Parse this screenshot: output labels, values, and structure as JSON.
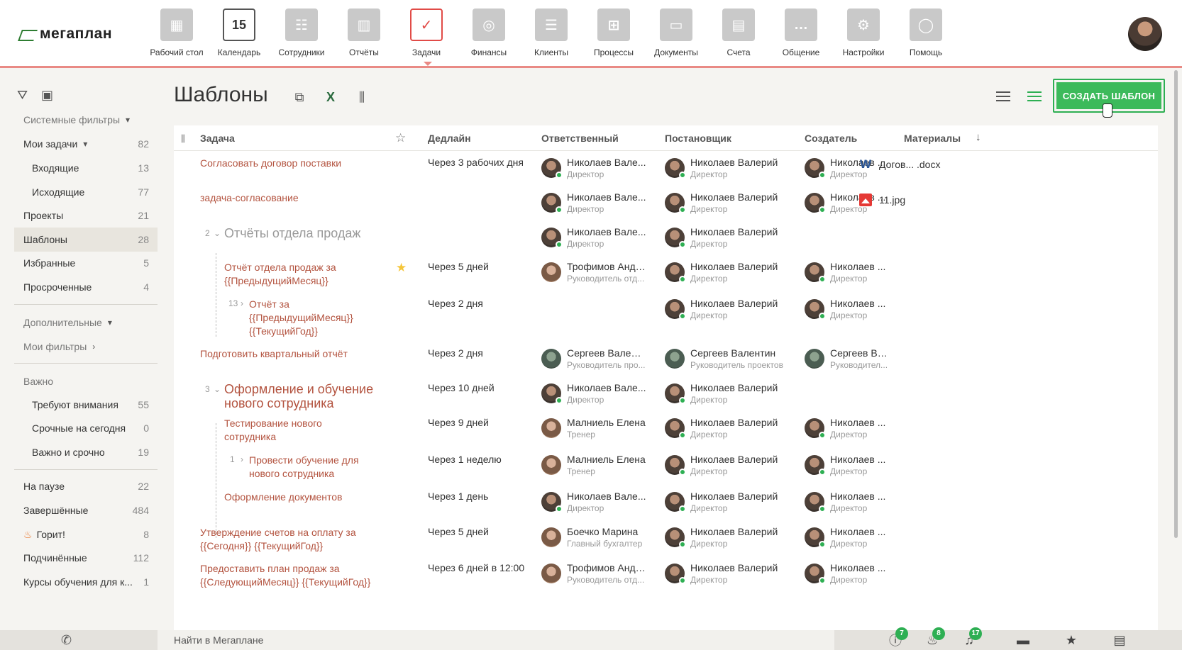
{
  "app": {
    "logo": "мегаплан"
  },
  "nav": [
    {
      "label": "Рабочий стол",
      "icon": "desktop-icon"
    },
    {
      "label": "Календарь",
      "icon": "calendar-icon",
      "day": "15"
    },
    {
      "label": "Сотрудники",
      "icon": "employees-icon"
    },
    {
      "label": "Отчёты",
      "icon": "reports-icon"
    },
    {
      "label": "Задачи",
      "icon": "tasks-icon",
      "active": true
    },
    {
      "label": "Финансы",
      "icon": "safe-icon"
    },
    {
      "label": "Клиенты",
      "icon": "clients-icon"
    },
    {
      "label": "Процессы",
      "icon": "processes-icon"
    },
    {
      "label": "Документы",
      "icon": "folder-icon"
    },
    {
      "label": "Счета",
      "icon": "invoice-icon"
    },
    {
      "label": "Общение",
      "icon": "chat-icon"
    },
    {
      "label": "Настройки",
      "icon": "gear-icon"
    },
    {
      "label": "Помощь",
      "icon": "lifebuoy-icon"
    }
  ],
  "sidebar": {
    "system_filters": "Системные фильтры",
    "items": [
      {
        "label": "Мои задачи",
        "count": "82"
      },
      {
        "label": "Входящие",
        "count": "13"
      },
      {
        "label": "Исходящие",
        "count": "77"
      },
      {
        "label": "Проекты",
        "count": "21"
      },
      {
        "label": "Шаблоны",
        "count": "28"
      },
      {
        "label": "Избранные",
        "count": "5"
      },
      {
        "label": "Просроченные",
        "count": "4"
      }
    ],
    "additional": "Дополнительные",
    "my_filters": "Мои фильтры",
    "important": "Важно",
    "important_items": [
      {
        "label": "Требуют внимания",
        "count": "55"
      },
      {
        "label": "Срочные на сегодня",
        "count": "0"
      },
      {
        "label": "Важно и срочно",
        "count": "19"
      }
    ],
    "bottom_items": [
      {
        "label": "На паузе",
        "count": "22"
      },
      {
        "label": "Завершённые",
        "count": "484"
      },
      {
        "label": "Горит!",
        "count": "8"
      },
      {
        "label": "Подчинённые",
        "count": "112"
      },
      {
        "label": "Курсы обучения для к...",
        "count": "1"
      }
    ]
  },
  "main": {
    "title": "Шаблоны",
    "create_button": "СОЗДАТЬ ШАБЛОН"
  },
  "table": {
    "columns": {
      "task": "Задача",
      "deadline": "Дедлайн",
      "responsible": "Ответственный",
      "setter": "Постановщик",
      "creator": "Создатель",
      "materials": "Материалы"
    },
    "rows": [
      {
        "task": "Согласовать договор поставки",
        "deadline": "Через 3 рабочих дня",
        "resp": {
          "name": "Николаев Вале...",
          "role": "Директор"
        },
        "setter": {
          "name": "Николаев Валерий",
          "role": "Директор"
        },
        "creator": {
          "name": "Николаев ...",
          "role": "Директор"
        },
        "file": "Догов... .docx"
      },
      {
        "task": "задача-согласование",
        "deadline": "",
        "resp": {
          "name": "Николаев Вале...",
          "role": "Директор"
        },
        "setter": {
          "name": "Николаев Валерий",
          "role": "Директор"
        },
        "creator": {
          "name": "Николаев ...",
          "role": "Директор"
        },
        "file": "11.jpg"
      },
      {
        "num": "2",
        "task": "Отчёты отдела продаж",
        "deadline": "",
        "resp": {
          "name": "Николаев Вале...",
          "role": "Директор"
        },
        "setter": {
          "name": "Николаев Валерий",
          "role": "Директор"
        }
      },
      {
        "task1": "Отчёт отдела продаж за",
        "task2": "{{ПредыдущийМесяц}}",
        "deadline": "Через 5 дней",
        "resp": {
          "name": "Трофимов Андр...",
          "role": "Руководитель отд..."
        },
        "setter": {
          "name": "Николаев Валерий",
          "role": "Директор"
        },
        "creator": {
          "name": "Николаев ...",
          "role": "Директор"
        }
      },
      {
        "num": "13",
        "task1": "Отчёт за",
        "task2": "{{ПредыдущийМесяц}}",
        "task3": "{{ТекущийГод}}",
        "deadline": "Через 2 дня",
        "setter": {
          "name": "Николаев Валерий",
          "role": "Директор"
        },
        "creator": {
          "name": "Николаев ...",
          "role": "Директор"
        }
      },
      {
        "task": "Подготовить квартальный отчёт",
        "deadline": "Через 2 дня",
        "resp": {
          "name": "Сергеев Валент...",
          "role": "Руководитель про..."
        },
        "setter": {
          "name": "Сергеев Валентин",
          "role": "Руководитель проектов"
        },
        "creator": {
          "name": "Сергеев Ва...",
          "role": "Руководител..."
        }
      },
      {
        "num": "3",
        "task1": "Оформление и обучение",
        "task2": "нового сотрудника",
        "deadline": "Через 10 дней",
        "resp": {
          "name": "Николаев Вале...",
          "role": "Директор"
        },
        "setter": {
          "name": "Николаев Валерий",
          "role": "Директор"
        }
      },
      {
        "task1": "Тестирование нового",
        "task2": "сотрудника",
        "deadline": "Через 9 дней",
        "resp": {
          "name": "Малниель Елена",
          "role": "Тренер"
        },
        "setter": {
          "name": "Николаев Валерий",
          "role": "Директор"
        },
        "creator": {
          "name": "Николаев ...",
          "role": "Директор"
        }
      },
      {
        "num": "1",
        "task1": "Провести обучение для",
        "task2": "нового сотрудника",
        "deadline": "Через 1 неделю",
        "resp": {
          "name": "Малниель Елена",
          "role": "Тренер"
        },
        "setter": {
          "name": "Николаев Валерий",
          "role": "Директор"
        },
        "creator": {
          "name": "Николаев ...",
          "role": "Директор"
        }
      },
      {
        "task": "Оформление документов",
        "deadline": "Через 1 день",
        "resp": {
          "name": "Николаев Вале...",
          "role": "Директор"
        },
        "setter": {
          "name": "Николаев Валерий",
          "role": "Директор"
        },
        "creator": {
          "name": "Николаев ...",
          "role": "Директор"
        }
      },
      {
        "task1": "Утверждение счетов на оплату за",
        "task2": "{{Сегодня}} {{ТекущийГод}}",
        "deadline": "Через 5 дней",
        "resp": {
          "name": "Боечко Марина",
          "role": "Главный бухгалтер"
        },
        "setter": {
          "name": "Николаев Валерий",
          "role": "Директор"
        },
        "creator": {
          "name": "Николаев ...",
          "role": "Директор"
        }
      },
      {
        "task1": "Предоставить план продаж за",
        "task2": "{{СледующийМесяц}} {{ТекущийГод}}",
        "deadline": "Через 6 дней в 12:00",
        "resp": {
          "name": "Трофимов Андр...",
          "role": "Руководитель отд..."
        },
        "setter": {
          "name": "Николаев Валерий",
          "role": "Директор"
        },
        "creator": {
          "name": "Николаев ...",
          "role": "Директор"
        }
      }
    ]
  },
  "bottom": {
    "search_placeholder": "Найти в Мегаплане",
    "badges": {
      "alerts": "7",
      "hot": "8",
      "notifications": "17"
    }
  }
}
